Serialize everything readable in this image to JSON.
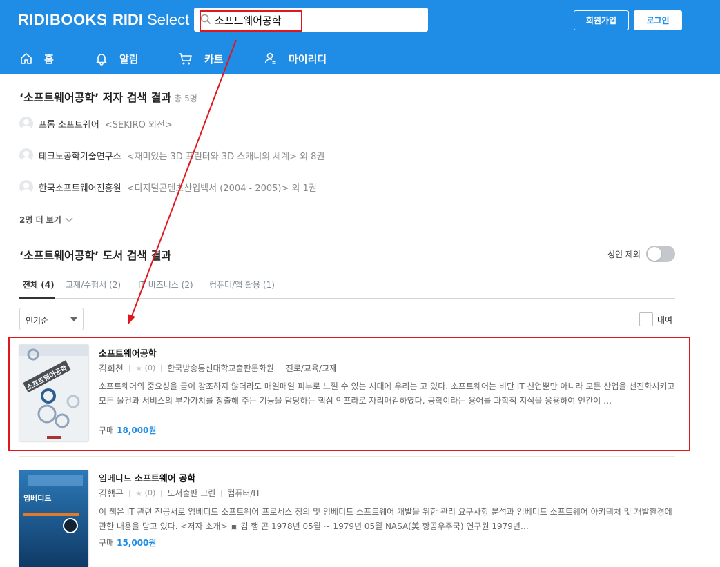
{
  "header": {
    "logo": "RIDIBOOKS",
    "logo2_bold": "RIDI",
    "logo2_light": "Select",
    "search_value": "소프트웨어공학",
    "join_label": "회원가입",
    "login_label": "로그인",
    "nav": [
      {
        "label": "홈",
        "icon": "home-icon"
      },
      {
        "label": "알림",
        "icon": "bell-icon"
      },
      {
        "label": "카트",
        "icon": "cart-icon"
      },
      {
        "label": "마이리디",
        "icon": "user-icon"
      }
    ]
  },
  "authors": {
    "title": "‘소프트웨어공학’ 저자 검색 결과",
    "count": "총 5명",
    "items": [
      {
        "name": "프롬 소프트웨어",
        "work": "<SEKIRO 외전>",
        "extra": ""
      },
      {
        "name": "테크노공학기술연구소",
        "work": "<재미있는 3D 프린터와 3D 스캐너의 세계>",
        "extra": "외 8권"
      },
      {
        "name": "한국소프트웨어진흥원",
        "work": "<디지털콘텐츠산업백서 (2004 - 2005)>",
        "extra": "외 1권"
      }
    ],
    "more": "2명 더 보기"
  },
  "books": {
    "title": "‘소프트웨어공학’ 도서 검색 결과",
    "adult_exclude": "성인 제외",
    "tabs": [
      "전체 (4)",
      "교재/수험서 (2)",
      "IT 비즈니스 (2)",
      "컴퓨터/앱 활용 (1)"
    ],
    "sort": "인기순",
    "rent": "대여",
    "items": [
      {
        "title": "소프트웨어공학",
        "title_prefix": "",
        "author": "김희천",
        "rating": "(0)",
        "publisher": "한국방송통신대학교출판문화원",
        "category": "진로/교육/교재",
        "desc": "소프트웨어의 중요성을 굳이 강조하지 않더라도 매일매일 피부로 느낄 수 있는 시대에 우리는 고 있다. 소프트웨어는 비단 IT 산업뿐만 아니라 모든 산업을 선진화시키고 모든 물건과 서비스의 부가가치를 창출해 주는 기능을 담당하는 핵심 인프라로 자리매김하였다. 공학이라는 용어를 과학적 지식을 응용하여 인간이 …",
        "price_label": "구매",
        "price": "18,000원",
        "cover_text": "소프트웨어공학"
      },
      {
        "title": "소프트웨어 공학",
        "title_prefix": "임베디드 ",
        "author": "김행곤",
        "rating": "(0)",
        "publisher": "도서출판 그린",
        "category": "컴퓨터/IT",
        "desc": "이 책은 IT 관련 전공서로 임베디드 소프트웨어 프로세스 정의 및 임베디드 소프트웨어 개발을 위한 관리 요구사항 분석과 임베디드 소프트웨어 아키텍처 및 개발환경에 관한 내용을 담고 있다. <저자 소개> ▣ 김 행 곤 1978년 05월 ~ 1979년 05월 NASA(美 항공우주국) 연구원 1979년…",
        "price_label": "구매",
        "price": "15,000원",
        "cover_text": "임베디드"
      }
    ]
  },
  "colors": {
    "brand": "#1f8ce6",
    "highlight": "#e0171c"
  }
}
